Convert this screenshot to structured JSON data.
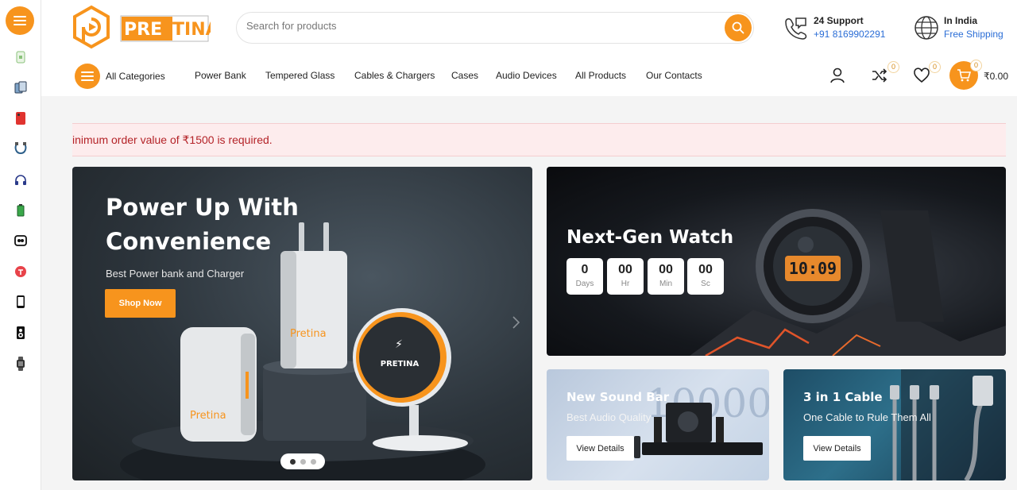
{
  "brand": {
    "name": "PRETINA",
    "primary_color": "#f7941d"
  },
  "sidebar": {
    "items": [
      {
        "icon": "charger-icon"
      },
      {
        "icon": "tempered-glass-icon"
      },
      {
        "icon": "phone-case-icon"
      },
      {
        "icon": "cable-icon"
      },
      {
        "icon": "headphones-icon"
      },
      {
        "icon": "battery-icon"
      },
      {
        "icon": "earbuds-icon"
      },
      {
        "icon": "speaker-round-icon"
      },
      {
        "icon": "mobile-phone-icon"
      },
      {
        "icon": "speaker-icon"
      },
      {
        "icon": "smartwatch-icon"
      }
    ]
  },
  "header": {
    "search_placeholder": "Search for products",
    "support": {
      "title": "24 Support",
      "phone": "+91 8169902291"
    },
    "region": {
      "title": "In India",
      "subtitle": "Free Shipping"
    }
  },
  "nav": {
    "all_categories": "All Categories",
    "links": [
      "Power Bank",
      "Tempered Glass",
      "Cables & Chargers",
      "Cases",
      "Audio Devices",
      "All Products",
      "Our Contacts"
    ],
    "compare_count": "0",
    "wishlist_count": "0",
    "cart_count": "0",
    "cart_total": "₹0.00"
  },
  "notice": {
    "text": "inimum order value of ₹1500 is required."
  },
  "hero": {
    "title": "Power Up With Convenience",
    "subtitle": "Best Power bank  and Charger",
    "button": "Shop Now",
    "slide_count": 3,
    "active_slide": 1,
    "product_labels": [
      "Pretina",
      "Pretina",
      "PRETINA"
    ]
  },
  "watch_banner": {
    "title": "Next-Gen Watch",
    "countdown": [
      {
        "value": "0",
        "label": "Days"
      },
      {
        "value": "00",
        "label": "Hr"
      },
      {
        "value": "00",
        "label": "Min"
      },
      {
        "value": "00",
        "label": "Sc"
      }
    ]
  },
  "sound_banner": {
    "title": "New Sound Bar",
    "subtitle": "Best Audio Quality",
    "button": "View Details",
    "bg_text": "10000"
  },
  "cable_banner": {
    "title": "3 in 1 Cable",
    "subtitle": "One Cable to Rule Them All",
    "button": "View Details"
  }
}
